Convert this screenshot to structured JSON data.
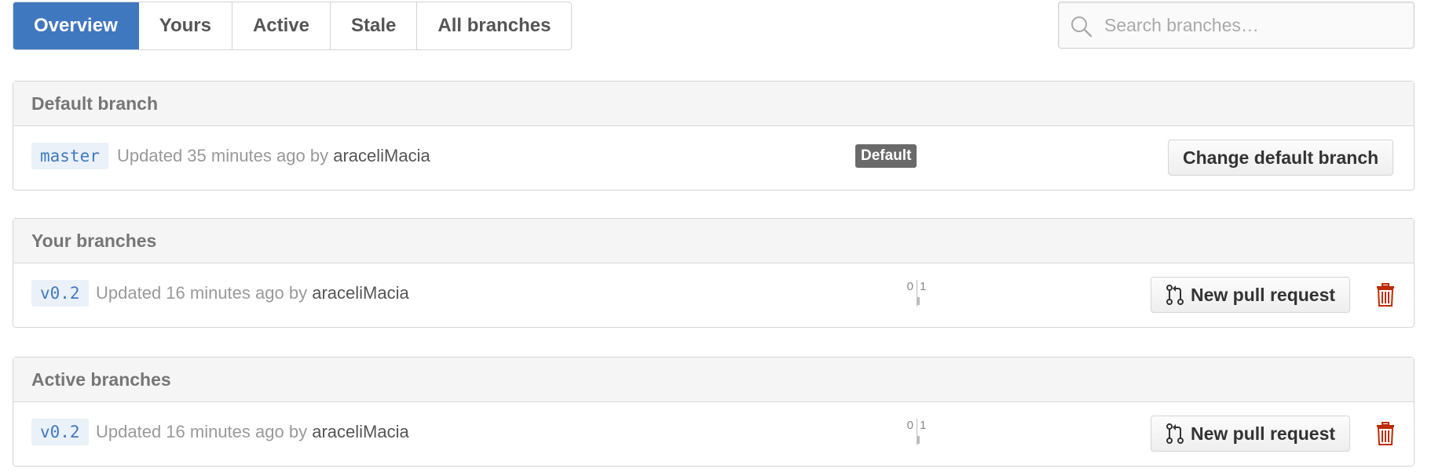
{
  "tabs": [
    {
      "label": "Overview",
      "selected": true
    },
    {
      "label": "Yours",
      "selected": false
    },
    {
      "label": "Active",
      "selected": false
    },
    {
      "label": "Stale",
      "selected": false
    },
    {
      "label": "All branches",
      "selected": false
    }
  ],
  "search": {
    "placeholder": "Search branches…",
    "value": "",
    "icon": "search-icon"
  },
  "default_section": {
    "title": "Default branch",
    "branch": {
      "name": "master",
      "updated_prefix": "Updated 35 minutes ago by",
      "author": "araceliMacia",
      "label": "Default",
      "button": "Change default branch"
    }
  },
  "your_section": {
    "title": "Your branches",
    "branch": {
      "name": "v0.2",
      "updated_prefix": "Updated 16 minutes ago by",
      "author": "araceliMacia",
      "behind": "0",
      "ahead": "1",
      "button": "New pull request"
    }
  },
  "active_section": {
    "title": "Active branches",
    "branch": {
      "name": "v0.2",
      "updated_prefix": "Updated 16 minutes ago by",
      "author": "araceliMacia",
      "behind": "0",
      "ahead": "1",
      "button": "New pull request"
    }
  },
  "colors": {
    "accent": "#4078c0",
    "branch_bg": "#eaf1f9",
    "delete": "#bd2c00",
    "default_label_bg": "#6a6a6a"
  }
}
